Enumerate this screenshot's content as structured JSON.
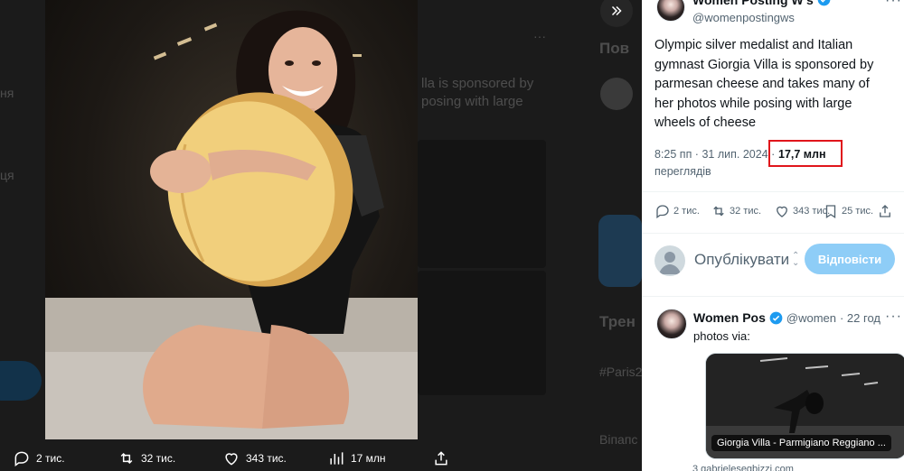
{
  "viewer": {
    "actions": [
      {
        "icon": "reply-icon",
        "label": "2 тис."
      },
      {
        "icon": "retweet-icon",
        "label": "32 тис."
      },
      {
        "icon": "like-icon",
        "label": "343 тис."
      },
      {
        "icon": "views-icon",
        "label": "17 млн"
      },
      {
        "icon": "share-icon",
        "label": ""
      }
    ],
    "expand_icon": "double-chevron-right-icon"
  },
  "background": {
    "ghost_text_1": "lla is sponsored by",
    "ghost_text_2": "posing with large",
    "ghost_section_1": "Пов",
    "ghost_section_2": "Трен",
    "ghost_hashtag": "#Paris2",
    "ghost_word": "Віпапс",
    "ghost_side_1": "ня",
    "ghost_side_2": "ця"
  },
  "tweet": {
    "author_name": "Women Posting W's",
    "author_handle": "@womenpostingws",
    "text": "Olympic silver medalist and Italian gymnast Giorgia Villa is sponsored by parmesan cheese and takes many of her photos while posing with large wheels of cheese",
    "time": "8:25 пп · 31 лип. 2024 ·",
    "views": "17,7 млн",
    "views_suffix": "переглядів",
    "actions": [
      {
        "icon": "reply-icon",
        "label": "2 тис."
      },
      {
        "icon": "retweet-icon",
        "label": "32 тис."
      },
      {
        "icon": "like-icon",
        "label": "343 тис."
      },
      {
        "icon": "bookmark-icon",
        "label": "25 тис."
      },
      {
        "icon": "share-icon",
        "label": ""
      }
    ]
  },
  "compose": {
    "placeholder": "Опублікувати",
    "button": "Відповісти"
  },
  "reply": {
    "author_name": "Women Pos",
    "author_handle": "@women",
    "time": "· 22 год",
    "text": "photos via:",
    "card_label": "Giorgia Villa - Parmigiano Reggiano ...",
    "card_domain": "3 gabrielesegbizzi.com"
  },
  "colors": {
    "highlight": "#e0151b",
    "verified": "#1d9bf0",
    "reply_button": "#8ecdf7"
  }
}
